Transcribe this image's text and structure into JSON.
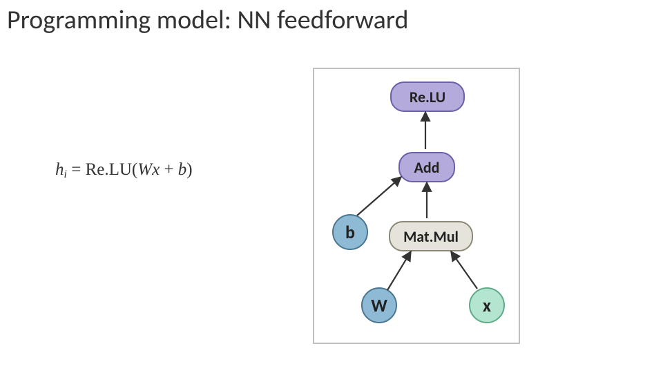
{
  "title": "Programming model: NN feedforward",
  "equation": {
    "lhs_var": "h",
    "lhs_sub": "i",
    "eq": " = ",
    "fn": "Re.LU",
    "open": "(",
    "W": "W",
    "x": "x",
    "plus": " + ",
    "b": "b",
    "close": ")"
  },
  "graph": {
    "nodes": {
      "relu": {
        "label": "Re.LU",
        "type": "op",
        "color": "purple"
      },
      "add": {
        "label": "Add",
        "type": "op",
        "color": "purple"
      },
      "matmul": {
        "label": "Mat.Mul",
        "type": "op",
        "color": "pale"
      },
      "b": {
        "label": "b",
        "type": "param",
        "color": "blue"
      },
      "W": {
        "label": "W",
        "type": "param",
        "color": "blue"
      },
      "x": {
        "label": "x",
        "type": "input",
        "color": "green"
      }
    },
    "edges": [
      {
        "from": "W",
        "to": "matmul"
      },
      {
        "from": "x",
        "to": "matmul"
      },
      {
        "from": "matmul",
        "to": "add"
      },
      {
        "from": "b",
        "to": "add"
      },
      {
        "from": "add",
        "to": "relu"
      }
    ]
  }
}
